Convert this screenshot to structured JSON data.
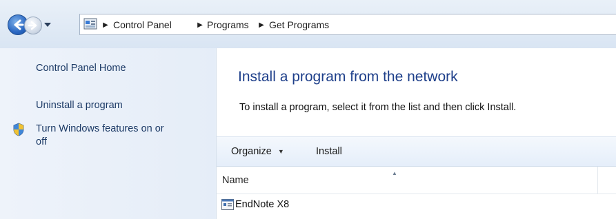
{
  "address_bar": {
    "breadcrumbs": [
      "Control Panel",
      "Programs",
      "Get Programs"
    ]
  },
  "left_pane": {
    "links": [
      "Control Panel Home",
      "Uninstall a program",
      "Turn Windows features on or",
      "off"
    ]
  },
  "main": {
    "title": "Install a program from the network",
    "instructions": "To install a program, select it from the list and then click Install."
  },
  "toolbar": {
    "organize_label": "Organize",
    "install_label": "Install"
  },
  "list": {
    "columns": [
      "Name"
    ],
    "rows": [
      {
        "name": "EndNote X8"
      }
    ]
  },
  "colors": {
    "title_blue": "#1e3f8a",
    "link_blue": "#1c3a66",
    "pane_bg": "#eef3fa",
    "toolbar_bg": "#e5eefa"
  }
}
